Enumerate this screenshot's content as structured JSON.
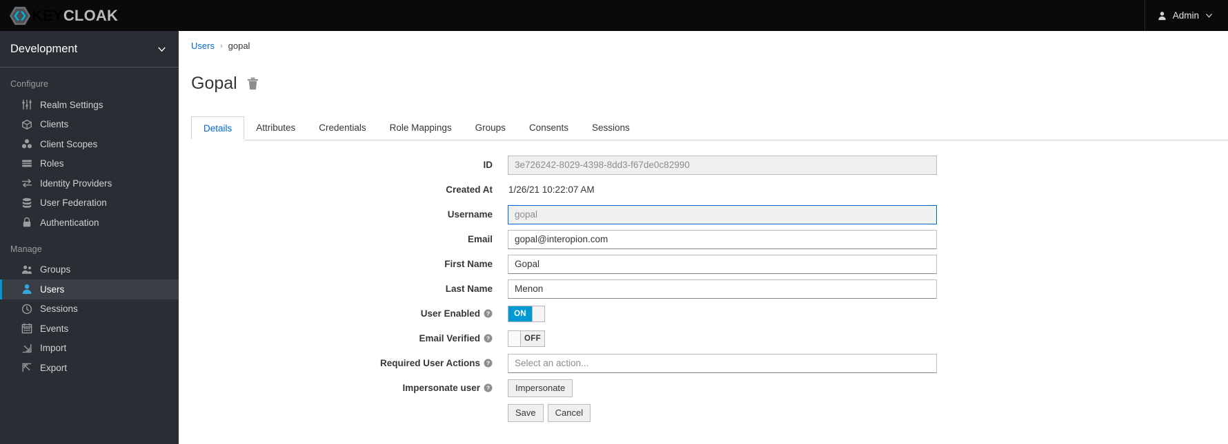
{
  "masthead": {
    "brand_key": "KEY",
    "brand_cloak": "CLOAK",
    "user_label": "Admin"
  },
  "sidebar": {
    "realm": "Development",
    "sections": [
      {
        "title": "Configure",
        "items": [
          {
            "label": "Realm Settings",
            "icon": "sliders-icon",
            "active": false
          },
          {
            "label": "Clients",
            "icon": "cube-icon",
            "active": false
          },
          {
            "label": "Client Scopes",
            "icon": "cubes-icon",
            "active": false
          },
          {
            "label": "Roles",
            "icon": "list-icon",
            "active": false
          },
          {
            "label": "Identity Providers",
            "icon": "exchange-icon",
            "active": false
          },
          {
            "label": "User Federation",
            "icon": "database-icon",
            "active": false
          },
          {
            "label": "Authentication",
            "icon": "lock-icon",
            "active": false
          }
        ]
      },
      {
        "title": "Manage",
        "items": [
          {
            "label": "Groups",
            "icon": "users-icon",
            "active": false
          },
          {
            "label": "Users",
            "icon": "user-icon",
            "active": true
          },
          {
            "label": "Sessions",
            "icon": "clock-icon",
            "active": false
          },
          {
            "label": "Events",
            "icon": "calendar-icon",
            "active": false
          },
          {
            "label": "Import",
            "icon": "import-arrow-icon",
            "active": false
          },
          {
            "label": "Export",
            "icon": "export-arrow-icon",
            "active": false
          }
        ]
      }
    ]
  },
  "breadcrumb": {
    "root": "Users",
    "separator": "›",
    "current": "gopal"
  },
  "page": {
    "title": "Gopal"
  },
  "tabs": [
    {
      "label": "Details",
      "active": true
    },
    {
      "label": "Attributes",
      "active": false
    },
    {
      "label": "Credentials",
      "active": false
    },
    {
      "label": "Role Mappings",
      "active": false
    },
    {
      "label": "Groups",
      "active": false
    },
    {
      "label": "Consents",
      "active": false
    },
    {
      "label": "Sessions",
      "active": false
    }
  ],
  "form": {
    "id": {
      "label": "ID",
      "value": "3e726242-8029-4398-8dd3-f67de0c82990"
    },
    "created_at": {
      "label": "Created At",
      "value": "1/26/21 10:22:07 AM"
    },
    "username": {
      "label": "Username",
      "value": "gopal"
    },
    "email": {
      "label": "Email",
      "value": "gopal@interopion.com"
    },
    "first_name": {
      "label": "First Name",
      "value": "Gopal"
    },
    "last_name": {
      "label": "Last Name",
      "value": "Menon"
    },
    "user_enabled": {
      "label": "User Enabled",
      "state": "ON"
    },
    "email_verified": {
      "label": "Email Verified",
      "state": "OFF"
    },
    "required_user_actions": {
      "label": "Required User Actions",
      "placeholder": "Select an action..."
    },
    "impersonate": {
      "label": "Impersonate user",
      "button": "Impersonate"
    },
    "save": "Save",
    "cancel": "Cancel"
  },
  "colors": {
    "accent_blue": "#0099d3",
    "link_blue": "#0066cc",
    "sidebar_bg": "#292e34",
    "masthead_bg": "#0a0a0a"
  }
}
